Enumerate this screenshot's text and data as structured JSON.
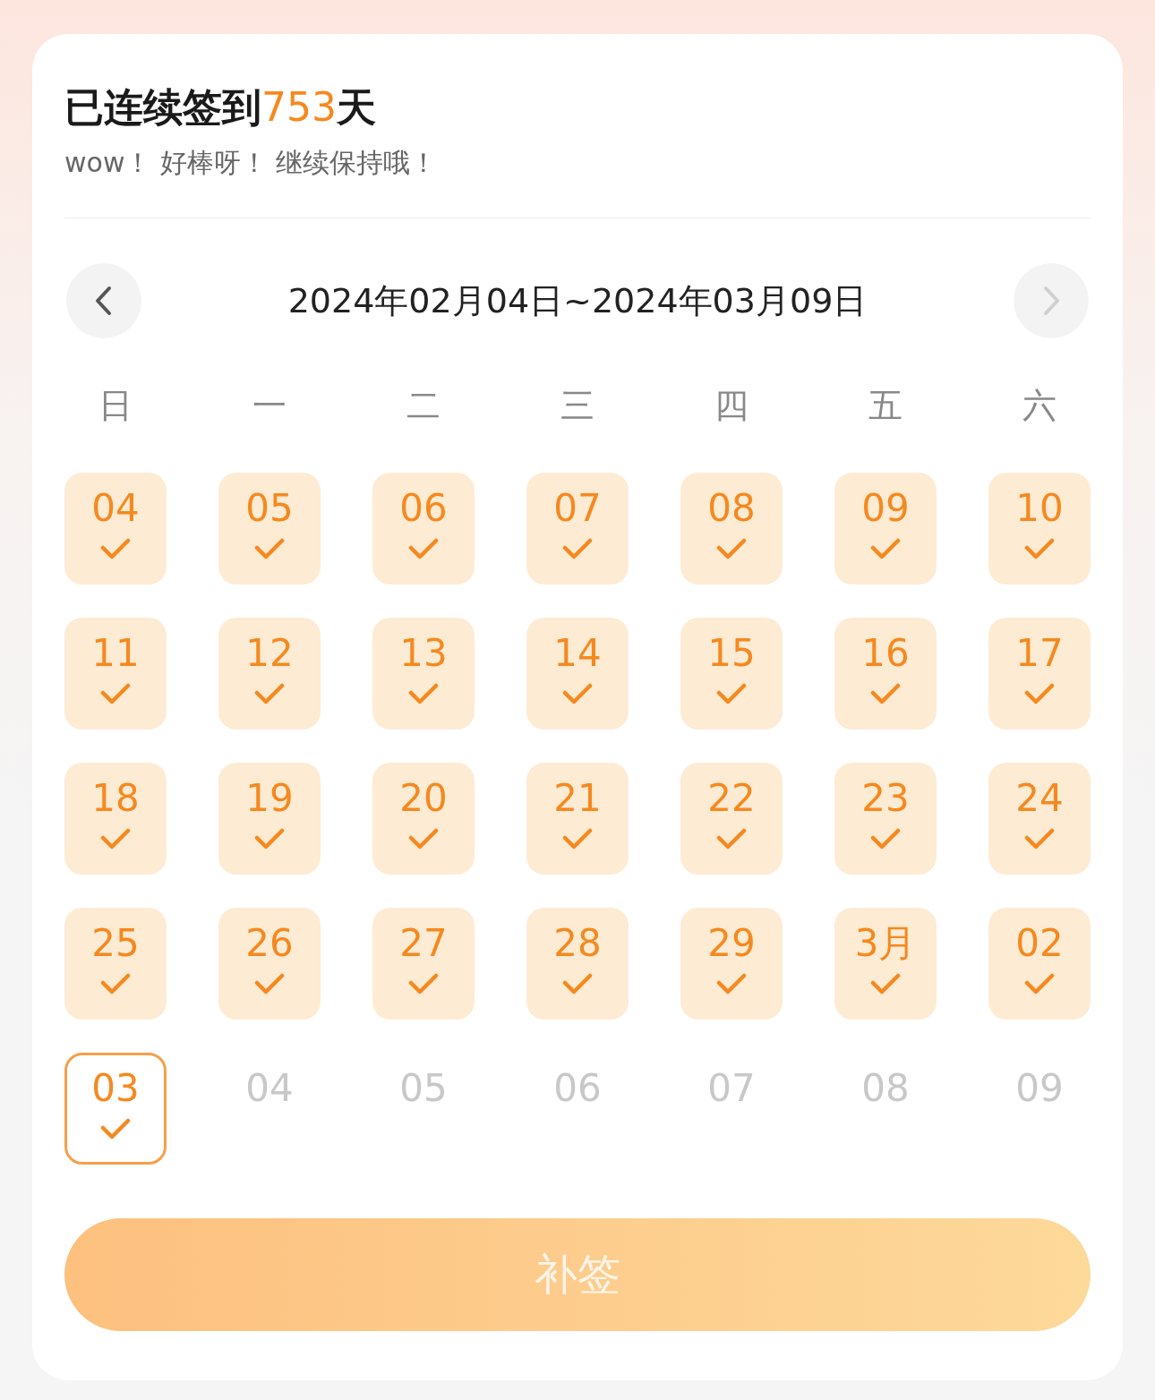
{
  "header": {
    "title_prefix": "已连续签到",
    "streak": "753",
    "title_suffix": "天",
    "subtitle": "wow！ 好棒呀！ 继续保持哦！"
  },
  "nav": {
    "range": "2024年02月04日~2024年03月09日",
    "prev_disabled": false,
    "next_disabled": true
  },
  "weekdays": [
    "日",
    "一",
    "二",
    "三",
    "四",
    "五",
    "六"
  ],
  "days": [
    {
      "label": "04",
      "signed": true,
      "today": false
    },
    {
      "label": "05",
      "signed": true,
      "today": false
    },
    {
      "label": "06",
      "signed": true,
      "today": false
    },
    {
      "label": "07",
      "signed": true,
      "today": false
    },
    {
      "label": "08",
      "signed": true,
      "today": false
    },
    {
      "label": "09",
      "signed": true,
      "today": false
    },
    {
      "label": "10",
      "signed": true,
      "today": false
    },
    {
      "label": "11",
      "signed": true,
      "today": false
    },
    {
      "label": "12",
      "signed": true,
      "today": false
    },
    {
      "label": "13",
      "signed": true,
      "today": false
    },
    {
      "label": "14",
      "signed": true,
      "today": false
    },
    {
      "label": "15",
      "signed": true,
      "today": false
    },
    {
      "label": "16",
      "signed": true,
      "today": false
    },
    {
      "label": "17",
      "signed": true,
      "today": false
    },
    {
      "label": "18",
      "signed": true,
      "today": false
    },
    {
      "label": "19",
      "signed": true,
      "today": false
    },
    {
      "label": "20",
      "signed": true,
      "today": false
    },
    {
      "label": "21",
      "signed": true,
      "today": false
    },
    {
      "label": "22",
      "signed": true,
      "today": false
    },
    {
      "label": "23",
      "signed": true,
      "today": false
    },
    {
      "label": "24",
      "signed": true,
      "today": false
    },
    {
      "label": "25",
      "signed": true,
      "today": false
    },
    {
      "label": "26",
      "signed": true,
      "today": false
    },
    {
      "label": "27",
      "signed": true,
      "today": false
    },
    {
      "label": "28",
      "signed": true,
      "today": false
    },
    {
      "label": "29",
      "signed": true,
      "today": false
    },
    {
      "label": "3月",
      "signed": true,
      "today": false
    },
    {
      "label": "02",
      "signed": true,
      "today": false
    },
    {
      "label": "03",
      "signed": true,
      "today": true
    },
    {
      "label": "04",
      "signed": false,
      "today": false
    },
    {
      "label": "05",
      "signed": false,
      "today": false
    },
    {
      "label": "06",
      "signed": false,
      "today": false
    },
    {
      "label": "07",
      "signed": false,
      "today": false
    },
    {
      "label": "08",
      "signed": false,
      "today": false
    },
    {
      "label": "09",
      "signed": false,
      "today": false
    }
  ],
  "makeup_button": {
    "label": "补签",
    "disabled": true
  }
}
